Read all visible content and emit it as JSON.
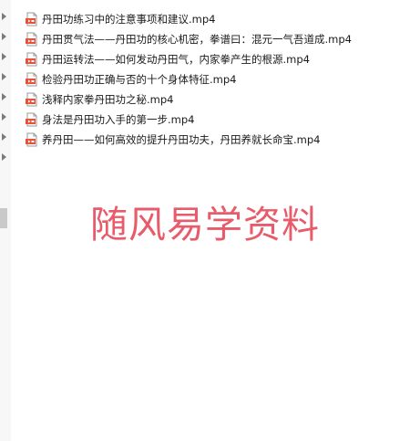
{
  "files": [
    {
      "name": "丹田功练习中的注意事项和建议.mp4",
      "icon": "mp4-file-icon"
    },
    {
      "name": "丹田贯气法——丹田功的核心机密，拳谱曰：混元一气吾道成.mp4",
      "icon": "mp4-file-icon"
    },
    {
      "name": "丹田运转法——如何发动丹田气，内家拳产生的根源.mp4",
      "icon": "mp4-file-icon"
    },
    {
      "name": "检验丹田功正确与否的十个身体特征.mp4",
      "icon": "mp4-file-icon"
    },
    {
      "name": "浅释内家拳丹田功之秘.mp4",
      "icon": "mp4-file-icon"
    },
    {
      "name": "身法是丹田功入手的第一步.mp4",
      "icon": "mp4-file-icon"
    },
    {
      "name": "养丹田——如何高效的提升丹田功夫，丹田养就长命宝.mp4",
      "icon": "mp4-file-icon"
    }
  ],
  "watermark": {
    "text": "随风易学资料",
    "color": "#e64a5a"
  },
  "colors": {
    "icon_accent": "#e8503a",
    "text": "#1a1a1a"
  }
}
